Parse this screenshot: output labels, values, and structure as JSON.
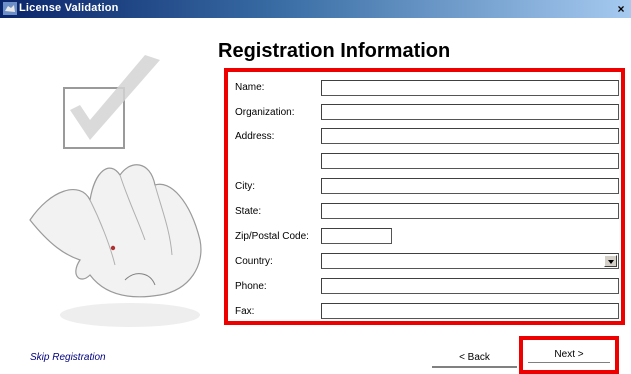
{
  "window": {
    "title": "License Validation",
    "close_glyph": "×"
  },
  "heading": "Registration Information",
  "fields": [
    {
      "label": "Name:",
      "value": ""
    },
    {
      "label": "Organization:",
      "value": ""
    },
    {
      "label": "Address:",
      "value": ""
    },
    {
      "label": "",
      "value": ""
    },
    {
      "label": "City:",
      "value": ""
    },
    {
      "label": "State:",
      "value": ""
    },
    {
      "label": "Zip/Postal Code:",
      "value": ""
    },
    {
      "label": "Country:",
      "value": ""
    },
    {
      "label": "Phone:",
      "value": ""
    },
    {
      "label": "Fax:",
      "value": ""
    }
  ],
  "footer": {
    "skip_label": "Skip Registration",
    "back_label": "< Back",
    "next_label": "Next >"
  },
  "colors": {
    "highlight": "#ee0000",
    "title_bar": "#0a246a",
    "link": "#000080"
  }
}
